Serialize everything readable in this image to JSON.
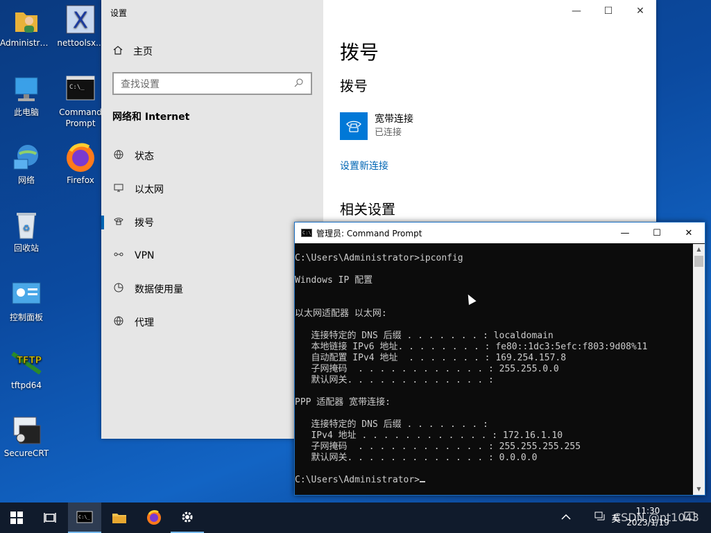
{
  "desktop": {
    "icons": [
      {
        "label": "Administra...",
        "icon": "user-folder-icon"
      },
      {
        "label": "nettoolsx...",
        "icon": "nettools-icon"
      },
      {
        "label": "此电脑",
        "icon": "computer-icon"
      },
      {
        "label": "Command\nPrompt",
        "icon": "cmd-icon"
      },
      {
        "label": "网络",
        "icon": "network-icon"
      },
      {
        "label": "Firefox",
        "icon": "firefox-icon"
      },
      {
        "label": "回收站",
        "icon": "recycle-bin-icon"
      },
      {
        "label": "控制面板",
        "icon": "control-panel-icon"
      },
      {
        "label": "tftpd64",
        "icon": "tftpd-icon"
      },
      {
        "label": "SecureCRT",
        "icon": "securecrt-icon"
      }
    ]
  },
  "settings": {
    "title": "设置",
    "home": "主页",
    "search_placeholder": "查找设置",
    "section": "网络和 Internet",
    "nav": [
      {
        "label": "状态",
        "icon": "globe-icon"
      },
      {
        "label": "以太网",
        "icon": "ethernet-icon"
      },
      {
        "label": "拨号",
        "icon": "dialup-icon",
        "selected": true
      },
      {
        "label": "VPN",
        "icon": "vpn-icon"
      },
      {
        "label": "数据使用量",
        "icon": "data-usage-icon"
      },
      {
        "label": "代理",
        "icon": "proxy-globe-icon"
      }
    ],
    "page_title": "拨号",
    "subtitle": "拨号",
    "connection": {
      "name": "宽带连接",
      "status": "已连接"
    },
    "new_connection_link": "设置新连接",
    "related_settings": "相关设置"
  },
  "cmd": {
    "title": "管理员: Command Prompt",
    "lines": [
      "C:\\Users\\Administrator>ipconfig",
      "",
      "Windows IP 配置",
      "",
      "",
      "以太网适配器 以太网:",
      "",
      "   连接特定的 DNS 后缀 . . . . . . . : localdomain",
      "   本地链接 IPv6 地址. . . . . . . . : fe80::1dc3:5efc:f803:9d08%11",
      "   自动配置 IPv4 地址  . . . . . . . : 169.254.157.8",
      "   子网掩码  . . . . . . . . . . . . : 255.255.0.0",
      "   默认网关. . . . . . . . . . . . . :",
      "",
      "PPP 适配器 宽带连接:",
      "",
      "   连接特定的 DNS 后缀 . . . . . . . :",
      "   IPv4 地址 . . . . . . . . . . . . : 172.16.1.10",
      "   子网掩码  . . . . . . . . . . . . : 255.255.255.255",
      "   默认网关. . . . . . . . . . . . . : 0.0.0.0",
      "",
      "C:\\Users\\Administrator>"
    ]
  },
  "taskbar": {
    "ime": "英",
    "time": "11:30",
    "date": "2023/1/19"
  },
  "watermark": "CSDN @pt1043",
  "colors": {
    "accent": "#0078d7",
    "taskbar": "#101b2c",
    "console_bg": "#0c0c0c",
    "console_fg": "#cccccc"
  }
}
